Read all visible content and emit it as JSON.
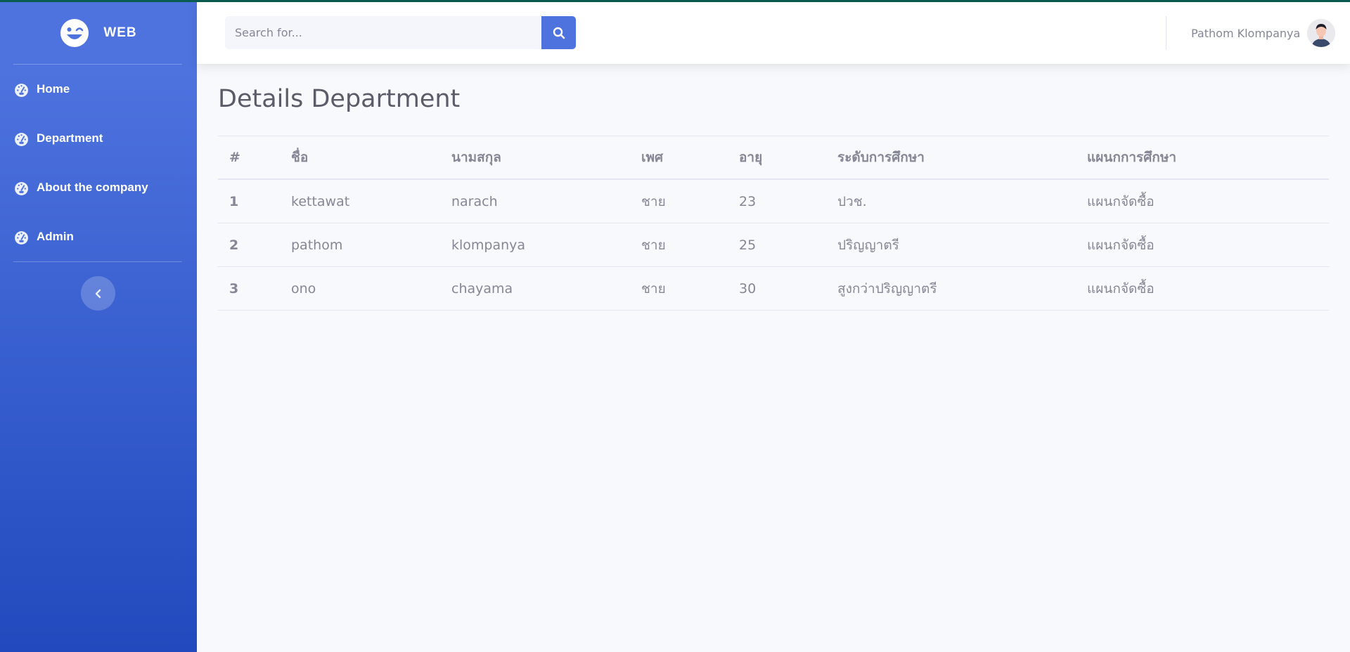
{
  "brand": {
    "name": "WEB",
    "icon": "laugh-wink-icon"
  },
  "sidebar": {
    "items": [
      {
        "label": "Home",
        "icon": "tachometer-icon"
      },
      {
        "label": "Department",
        "icon": "tachometer-icon"
      },
      {
        "label": "About the company",
        "icon": "tachometer-icon"
      },
      {
        "label": "Admin",
        "icon": "tachometer-icon"
      }
    ],
    "toggle_icon": "chevron-left-icon"
  },
  "topbar": {
    "search": {
      "placeholder": "Search for...",
      "value": ""
    },
    "search_icon": "search-icon",
    "user_name": "Pathom Klompanya"
  },
  "page": {
    "title": "Details Department"
  },
  "table": {
    "headers": [
      "#",
      "ชื่อ",
      "นามสกุล",
      "เพศ",
      "อายุ",
      "ระดับการศึกษา",
      "แผนกการศึกษา"
    ],
    "rows": [
      [
        "1",
        "kettawat",
        "narach",
        "ชาย",
        "23",
        "ปวช.",
        "แผนกจัดซื้อ"
      ],
      [
        "2",
        "pathom",
        "klompanya",
        "ชาย",
        "25",
        "ปริญญาตรี",
        "แผนกจัดซื้อ"
      ],
      [
        "3",
        "ono",
        "chayama",
        "ชาย",
        "30",
        "สูงกว่าปริญญาตรี",
        "แผนกจัดซื้อ"
      ]
    ]
  },
  "colors": {
    "primary": "#4e73df",
    "sidebar_bottom": "#224abe",
    "text_muted": "#858796",
    "background": "#f8f9fc"
  }
}
